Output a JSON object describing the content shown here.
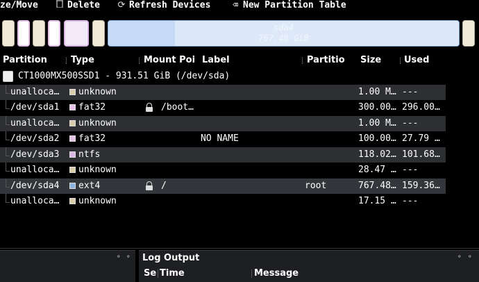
{
  "toolbar": {
    "resize_move": "ze/Move",
    "delete": "Delete",
    "refresh": "Refresh Devices",
    "new_table": "New Partition Table"
  },
  "map": {
    "sda4_name": "sda4",
    "sda4_size": "767.48 GiB"
  },
  "columns": {
    "partition": "Partition",
    "type": "Type",
    "mount_point": "Mount Poi",
    "label": "Label",
    "partition_name": "Partitio",
    "size": "Size",
    "used": "Used"
  },
  "device": {
    "label": "CT1000MX500SSD1 - 931.51 GiB (/dev/sda)"
  },
  "rows": [
    {
      "partition": "unalloca…",
      "type": "unknown",
      "mount": "",
      "label": "",
      "name": "",
      "size": "1.00 M…",
      "used": "---"
    },
    {
      "partition": "/dev/sda1",
      "type": "fat32",
      "mount": "/boot…",
      "label": "",
      "name": "",
      "size": "300.00…",
      "used": "296.00…"
    },
    {
      "partition": "unalloca…",
      "type": "unknown",
      "mount": "",
      "label": "",
      "name": "",
      "size": "1.00 M…",
      "used": "---"
    },
    {
      "partition": "/dev/sda2",
      "type": "fat32",
      "mount": "",
      "label": "NO NAME",
      "name": "",
      "size": "100.00…",
      "used": "27.79 …"
    },
    {
      "partition": "/dev/sda3",
      "type": "ntfs",
      "mount": "",
      "label": "",
      "name": "",
      "size": "118.02…",
      "used": "101.68…"
    },
    {
      "partition": "unalloca…",
      "type": "unknown",
      "mount": "",
      "label": "",
      "name": "",
      "size": "28.47 …",
      "used": "---"
    },
    {
      "partition": "/dev/sda4",
      "type": "ext4",
      "mount": "/",
      "label": "",
      "name": "root",
      "size": "767.48…",
      "used": "159.36…"
    },
    {
      "partition": "unalloca…",
      "type": "unknown",
      "mount": "",
      "label": "",
      "name": "",
      "size": "17.15 …",
      "used": "---"
    }
  ],
  "log": {
    "title": "Log Output",
    "col_severity": "Se",
    "col_time": "Time",
    "col_message": "Message"
  },
  "colors": {
    "unknown": "#d9ccaa",
    "fat32": "#e7c2e8",
    "ntfs": "#dcb8e6",
    "ext4": "#8fb1df"
  }
}
